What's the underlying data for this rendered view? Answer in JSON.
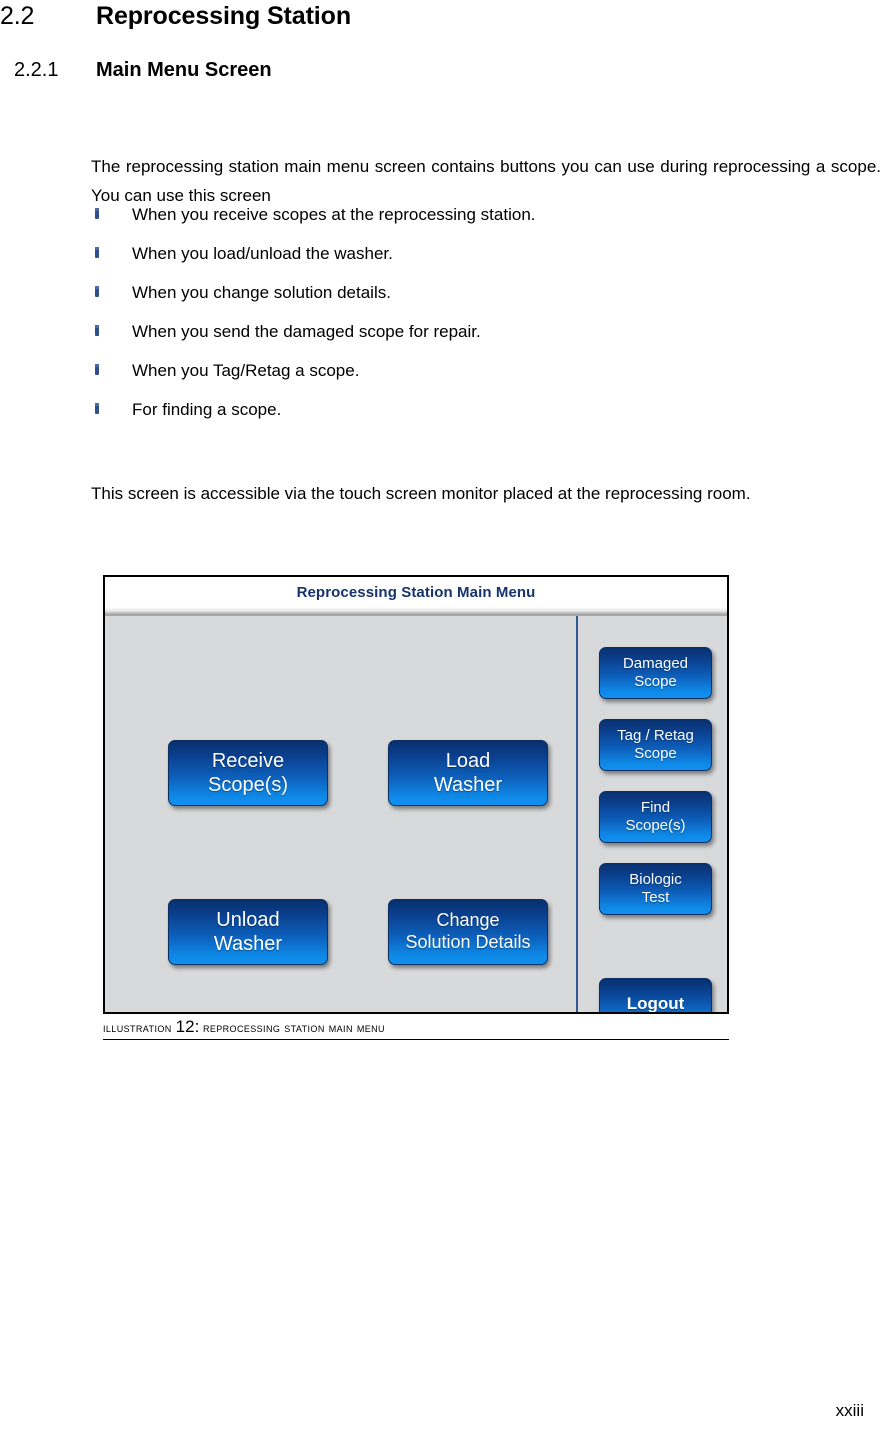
{
  "section": {
    "number": "2.2",
    "title": "Reprocessing Station"
  },
  "subsection": {
    "number": "2.2.1",
    "title": "Main Menu Screen"
  },
  "body": {
    "intro_paragraph": "The reprocessing station main menu screen contains buttons you can use during reprocessing a scope. You can use this screen",
    "bullets": [
      "When you receive scopes at the reprocessing station.",
      "When you load/unload the washer.",
      "When you change solution details.",
      "When you send the damaged scope for repair.",
      "When you Tag/Retag a scope.",
      "For finding a scope."
    ],
    "access_paragraph": "This screen is accessible via the touch screen monitor placed at the reprocessing room."
  },
  "figure": {
    "screen": {
      "title": "Reprocessing Station Main Menu",
      "main_buttons": [
        {
          "id": "receive-scopes",
          "label": "Receive\nScope(s)"
        },
        {
          "id": "load-washer",
          "label": "Load\nWasher"
        },
        {
          "id": "unload-washer",
          "label": "Unload\nWasher"
        },
        {
          "id": "change-solution-details",
          "label": "Change\nSolution Details"
        }
      ],
      "side_buttons": [
        {
          "id": "damaged-scope",
          "label": "Damaged\nScope"
        },
        {
          "id": "tag-retag-scope",
          "label": "Tag / Retag\nScope"
        },
        {
          "id": "find-scopes",
          "label": "Find\nScope(s)"
        },
        {
          "id": "biologic-test",
          "label": "Biologic\nTest"
        }
      ],
      "logout_button": {
        "id": "logout",
        "label": "Logout"
      },
      "colors": {
        "panel_background": "#d7d9db",
        "title_text": "#17336b",
        "divider": "#31588f",
        "button_gradient_top": "#08306e",
        "button_gradient_bottom": "#1090ef",
        "button_text": "#ffffff"
      }
    },
    "caption": {
      "prefix": "Illustration",
      "number": "12",
      "separator": ":",
      "text": "Reprocessing station main menu"
    }
  },
  "footer": {
    "page_number": "xxiii"
  }
}
